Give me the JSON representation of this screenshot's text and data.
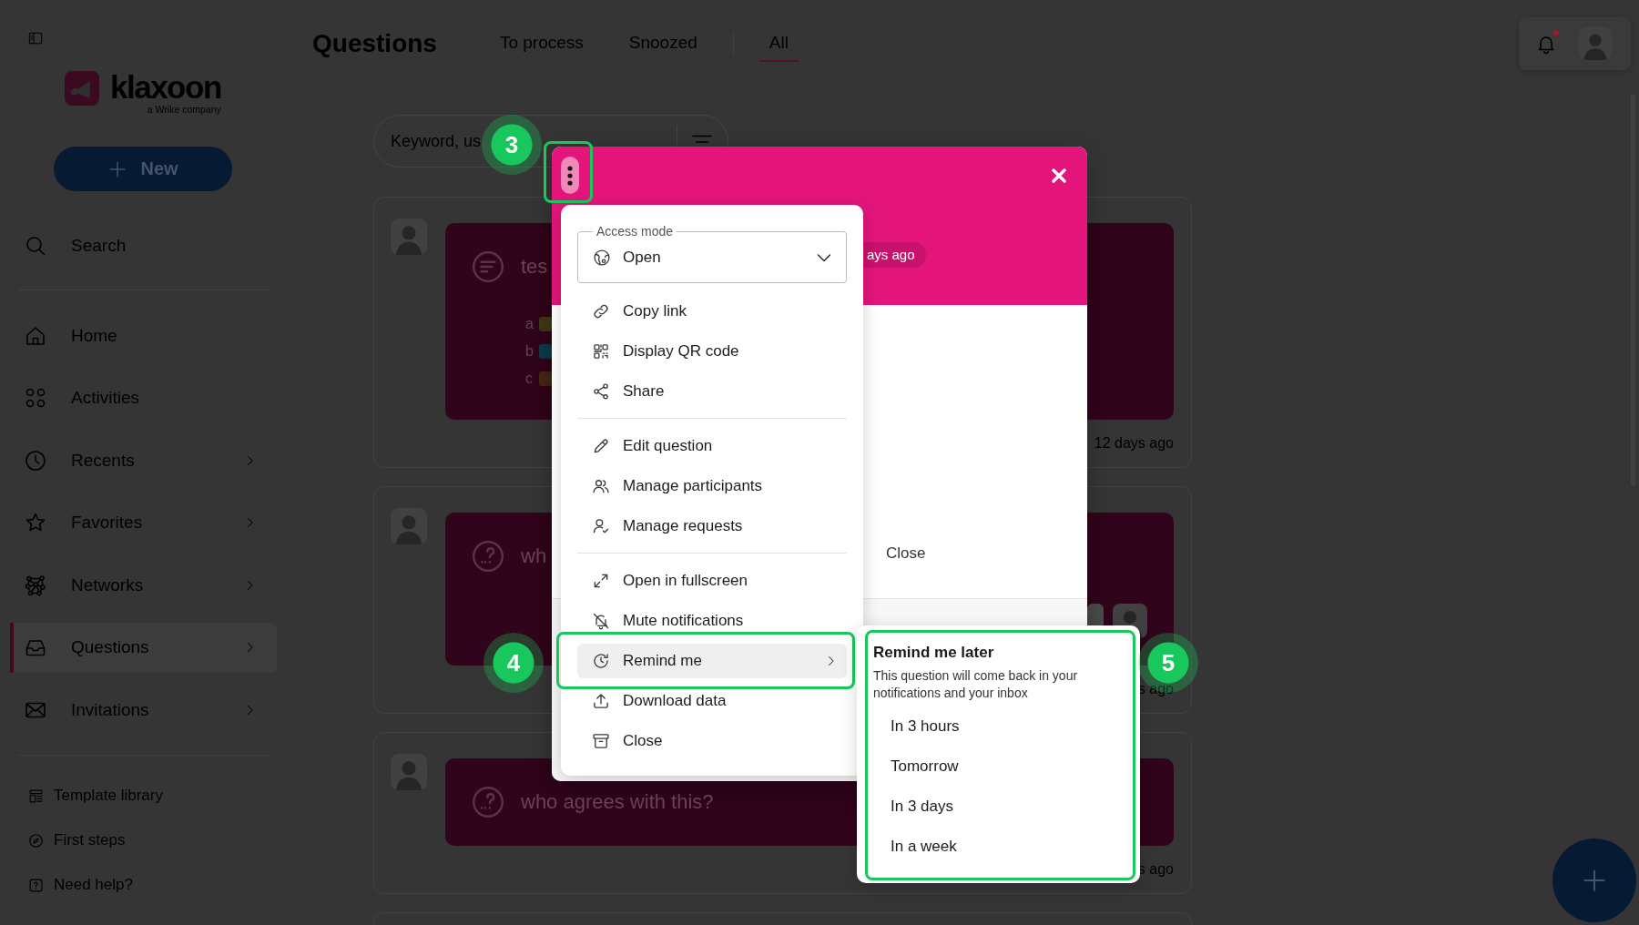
{
  "sidebar": {
    "logo": {
      "name": "klaxoon",
      "tagline": "a Wrike company"
    },
    "new_button": "New",
    "search": "Search",
    "nav": [
      {
        "label": "Home",
        "has_submenu": false,
        "selected": false
      },
      {
        "label": "Activities",
        "has_submenu": false,
        "selected": false
      },
      {
        "label": "Recents",
        "has_submenu": true,
        "selected": false
      },
      {
        "label": "Favorites",
        "has_submenu": true,
        "selected": false
      },
      {
        "label": "Networks",
        "has_submenu": true,
        "selected": false
      },
      {
        "label": "Questions",
        "has_submenu": true,
        "selected": true
      },
      {
        "label": "Invitations",
        "has_submenu": true,
        "selected": false
      }
    ],
    "footer_links": [
      "Template library",
      "First steps",
      "Need help?"
    ]
  },
  "header": {
    "title": "Questions",
    "tabs": [
      {
        "label": "To process",
        "selected": false
      },
      {
        "label": "Snoozed",
        "selected": false
      },
      {
        "label": "All",
        "selected": true
      }
    ],
    "notifications": {
      "unread": true
    }
  },
  "search": {
    "placeholder": "Keyword, us"
  },
  "cards": [
    {
      "kind": "poll",
      "title": "tes",
      "options": [
        {
          "label": "a",
          "color": "#403714"
        },
        {
          "label": "b",
          "color": "#0d3a4a"
        },
        {
          "label": "c",
          "color": "#45260f"
        }
      ],
      "show_participants": false,
      "time": "12 days ago"
    },
    {
      "kind": "question",
      "title": "wh",
      "show_participants": true,
      "time": "s ago"
    },
    {
      "kind": "question",
      "title": "who agrees with this?",
      "show_participants": false,
      "time": "s ago"
    }
  ],
  "modal": {
    "more_button": {
      "highlighted": true
    },
    "time_chip": "ays ago",
    "close_label": "Close"
  },
  "menu": {
    "access_mode": {
      "label": "Access mode",
      "value": "Open"
    },
    "groups": [
      [
        {
          "label": "Copy link",
          "selected": false,
          "has_submenu": false,
          "highlighted": false
        },
        {
          "label": "Display QR code",
          "selected": false,
          "has_submenu": false,
          "highlighted": false
        },
        {
          "label": "Share",
          "selected": false,
          "has_submenu": false,
          "highlighted": false
        }
      ],
      [
        {
          "label": "Edit question",
          "selected": false,
          "has_submenu": false,
          "highlighted": false
        },
        {
          "label": "Manage participants",
          "selected": false,
          "has_submenu": false,
          "highlighted": false
        },
        {
          "label": "Manage requests",
          "selected": false,
          "has_submenu": false,
          "highlighted": false
        }
      ],
      [
        {
          "label": "Open in fullscreen",
          "selected": false,
          "has_submenu": false,
          "highlighted": false
        },
        {
          "label": "Mute notifications",
          "selected": false,
          "has_submenu": false,
          "highlighted": false
        },
        {
          "label": "Remind me",
          "selected": true,
          "has_submenu": true,
          "highlighted": true
        },
        {
          "label": "Download data",
          "selected": false,
          "has_submenu": false,
          "highlighted": false
        },
        {
          "label": "Close",
          "selected": false,
          "has_submenu": false,
          "highlighted": false
        }
      ]
    ]
  },
  "submenu": {
    "title": "Remind me later",
    "description": "This question will come back in your notifications and your inbox",
    "options": [
      "In 3 hours",
      "Tomorrow",
      "In 3 days",
      "In a week"
    ],
    "highlighted": true
  },
  "callouts": [
    {
      "number": "3"
    },
    {
      "number": "4"
    },
    {
      "number": "5"
    }
  ]
}
